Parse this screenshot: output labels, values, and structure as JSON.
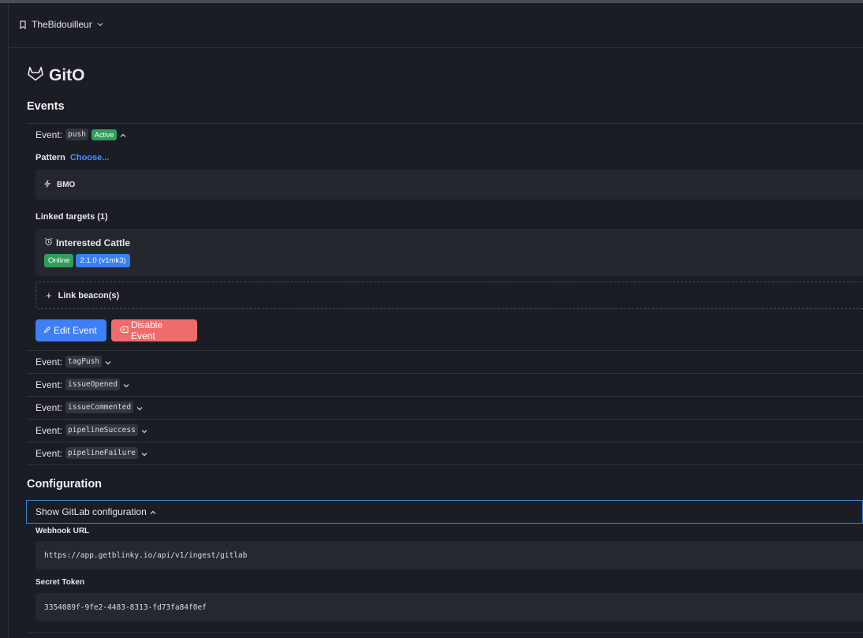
{
  "workspace": {
    "name": "TheBidouilleur"
  },
  "app": {
    "title": "GitO"
  },
  "events_section": {
    "heading": "Events",
    "expanded_event": {
      "label": "Event:",
      "name": "push",
      "status": "Active",
      "pattern_label": "Pattern",
      "pattern_action": "Choose...",
      "pattern_value": "BMO",
      "linked_targets_label": "Linked targets (1)",
      "target": {
        "name": "Interested Cattle",
        "status": "Online",
        "version": "2.1.0 (v1mk3)"
      },
      "link_beacon": "Link beacon(s)",
      "edit_button": "Edit Event",
      "disable_button": "Disable Event"
    },
    "collapsed_events": [
      {
        "label": "Event:",
        "name": "tagPush"
      },
      {
        "label": "Event:",
        "name": "issueOpened"
      },
      {
        "label": "Event:",
        "name": "issueCommented"
      },
      {
        "label": "Event:",
        "name": "pipelineSuccess"
      },
      {
        "label": "Event:",
        "name": "pipelineFailure"
      }
    ]
  },
  "configuration": {
    "heading": "Configuration",
    "toggle_label": "Show GitLab configuration",
    "webhook_label": "Webhook URL",
    "webhook_url": "https://app.getblinky.io/api/v1/ingest/gitlab",
    "secret_label": "Secret Token",
    "secret_token": "3354089f-9fe2-4483-8313-fd73fa84f0ef"
  },
  "colors": {
    "accent": "#3d7ff5",
    "danger": "#f06c6c",
    "success": "#2f9e5b",
    "background": "#1b1d24"
  }
}
